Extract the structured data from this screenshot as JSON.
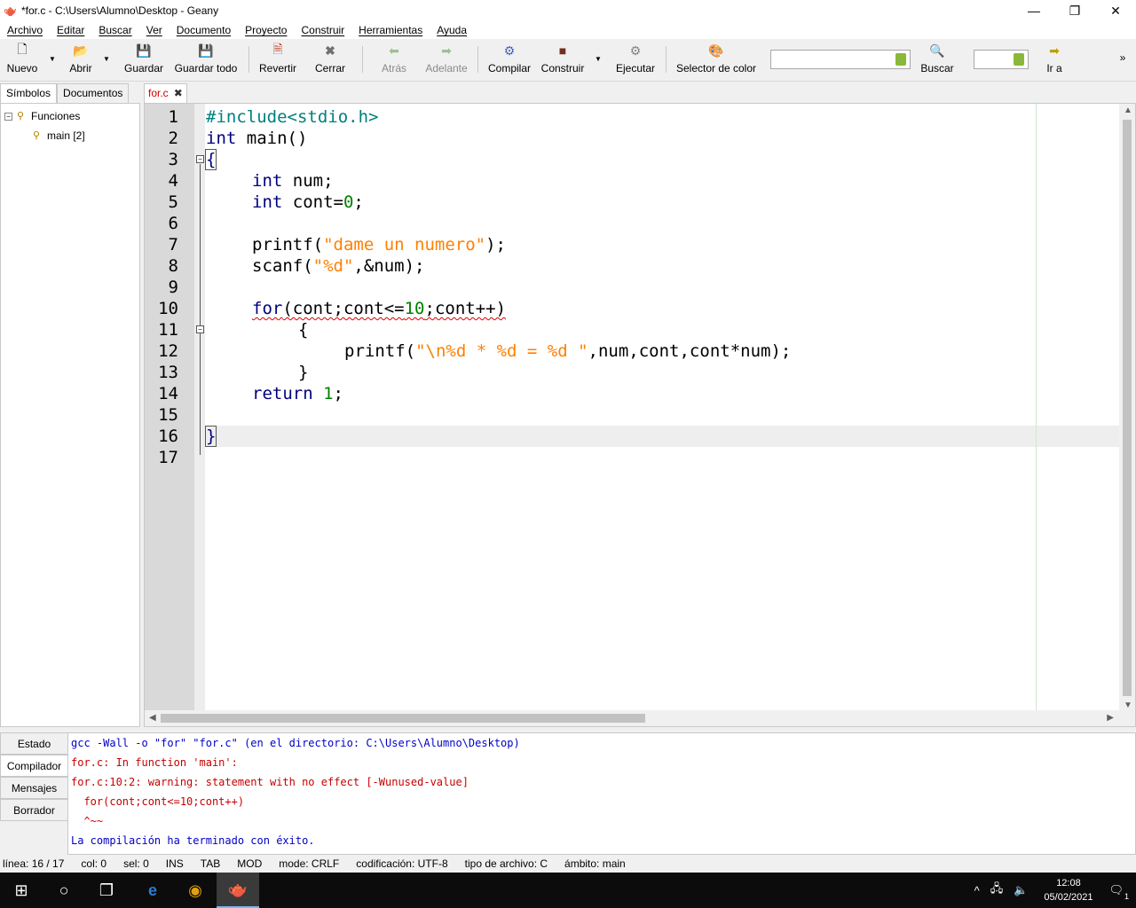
{
  "window": {
    "title": "*for.c - C:\\Users\\Alumno\\Desktop - Geany",
    "app_icon": "geany-teapot-icon",
    "minimize": "—",
    "maximize": "❐",
    "close": "✕"
  },
  "menubar": {
    "items": [
      "Archivo",
      "Editar",
      "Buscar",
      "Ver",
      "Documento",
      "Proyecto",
      "Construir",
      "Herramientas",
      "Ayuda"
    ]
  },
  "toolbar": {
    "new": "Nuevo",
    "open": "Abrir",
    "save": "Guardar",
    "save_all": "Guardar todo",
    "revert": "Revertir",
    "close": "Cerrar",
    "back": "Atrás",
    "forward": "Adelante",
    "compile": "Compilar",
    "build": "Construir",
    "execute": "Ejecutar",
    "color_picker": "Selector de color",
    "search_value": "",
    "search": "Buscar",
    "goto_value": "",
    "goto": "Ir a",
    "overflow": "»"
  },
  "sidebar": {
    "tabs": [
      "Símbolos",
      "Documentos"
    ],
    "active_tab": "Símbolos",
    "tree": {
      "group": "Funciones",
      "group_toggle": "−",
      "child": "main [2]"
    }
  },
  "document_tab": {
    "name": "for.c",
    "close": "✖"
  },
  "editor": {
    "current_line": 16,
    "lines": [
      {
        "no": "1"
      },
      {
        "no": "2"
      },
      {
        "no": "3"
      },
      {
        "no": "4"
      },
      {
        "no": "5"
      },
      {
        "no": "6"
      },
      {
        "no": "7"
      },
      {
        "no": "8"
      },
      {
        "no": "9"
      },
      {
        "no": "10"
      },
      {
        "no": "11"
      },
      {
        "no": "12"
      },
      {
        "no": "13"
      },
      {
        "no": "14"
      },
      {
        "no": "15"
      },
      {
        "no": "16"
      },
      {
        "no": "17"
      }
    ],
    "code": {
      "l1": "#include<stdio.h>",
      "l2_kw": "int",
      "l2_rest": " main()",
      "l3": "{",
      "l4_kw": "int",
      "l4_rest": " num;",
      "l5_kw": "int",
      "l5_a": " cont=",
      "l5_num": "0",
      "l5_b": ";",
      "l7_a": "printf(",
      "l7_str": "\"dame un numero\"",
      "l7_b": ");",
      "l8_a": "scanf(",
      "l8_str": "\"%d\"",
      "l8_b": ",&num);",
      "l10_kw": "for",
      "l10_a": "(cont;cont<=",
      "l10_num": "10",
      "l10_b": ";cont++)",
      "l11": "{",
      "l12_a": "printf(",
      "l12_str": "\"\\n%d * %d = %d \"",
      "l12_b": ",num,cont,cont*num);",
      "l13": "}",
      "l14_kw": "return",
      "l14_sp": " ",
      "l14_num": "1",
      "l14_b": ";",
      "l16": "}"
    }
  },
  "message_tabs": [
    "Estado",
    "Compilador",
    "Mensajes",
    "Borrador"
  ],
  "active_message_tab": "Compilador",
  "compiler_output": [
    {
      "text": "gcc -Wall -o \"for\" \"for.c\" (en el directorio: C:\\Users\\Alumno\\Desktop)",
      "color": "#0000c8"
    },
    {
      "text": "for.c: In function 'main':",
      "color": "#c80000"
    },
    {
      "text": "for.c:10:2: warning: statement with no effect [-Wunused-value]",
      "color": "#c80000"
    },
    {
      "text": "  for(cont;cont<=10;cont++)",
      "color": "#c80000"
    },
    {
      "text": "  ^~~",
      "color": "#c80000"
    },
    {
      "text": "La compilación ha terminado con éxito.",
      "color": "#0000c8"
    }
  ],
  "statusbar": {
    "line": "línea: 16 / 17",
    "col": "col: 0",
    "sel": "sel: 0",
    "ins": "INS",
    "tab": "TAB",
    "mod": "MOD",
    "mode": "mode: CRLF",
    "encoding": "codificación: UTF-8",
    "filetype": "tipo de archivo: C",
    "scope": "ámbito: main"
  },
  "taskbar": {
    "time": "12:08",
    "date": "05/02/2021",
    "notifications": "1"
  },
  "colors": {
    "keyword": "#00007f",
    "string": "#ff8000",
    "number": "#007f00",
    "preprocessor": "#007f7f",
    "error_text": "#c80000",
    "info_text": "#0000c8"
  }
}
